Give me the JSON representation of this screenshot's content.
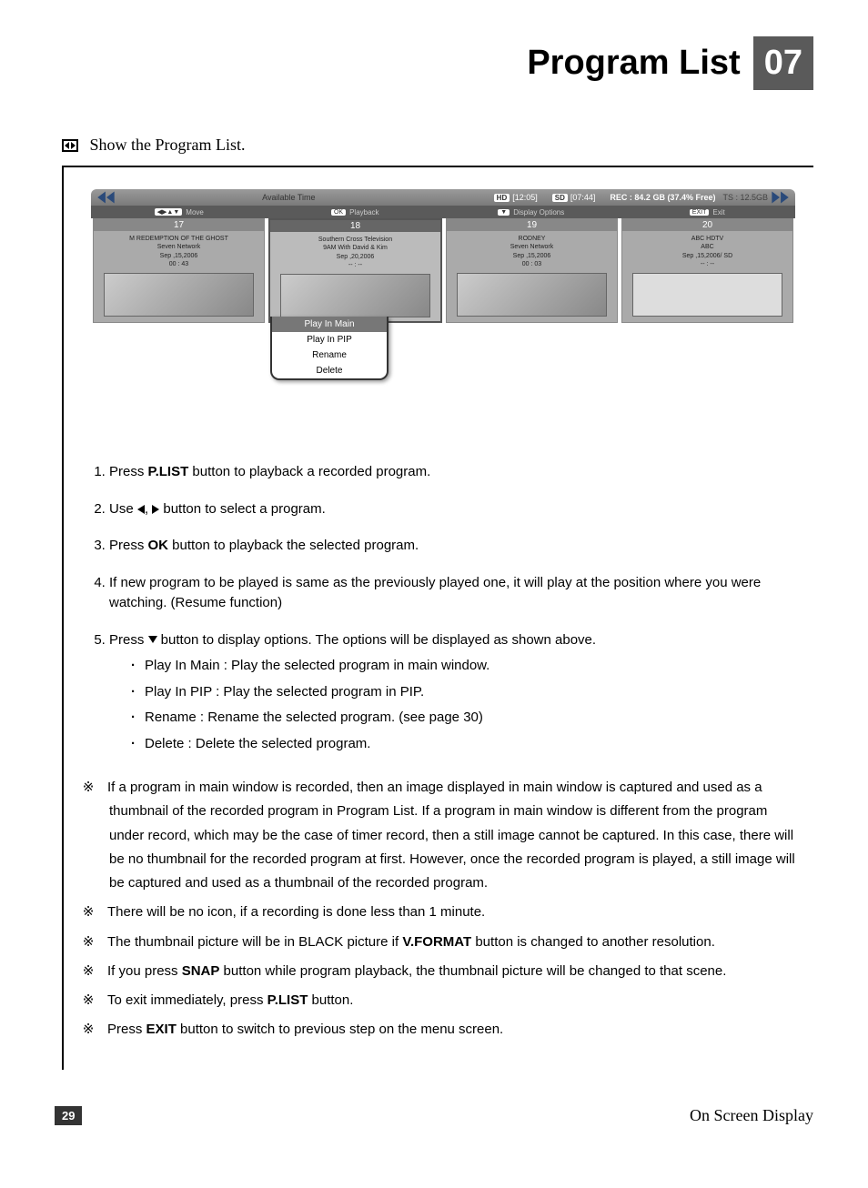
{
  "header": {
    "title": "Program List",
    "number": "07"
  },
  "intro": "Show the Program List.",
  "osd": {
    "availableLabel": "Available Time",
    "hd": "HD",
    "hdTime": "[12:05]",
    "sd": "SD",
    "sdTime": "[07:44]",
    "rec": "REC : 84.2 GB (37.4% Free)",
    "ts": "TS : 12.5GB",
    "hints": {
      "moveKey": "◀▶▲▼",
      "move": "Move",
      "okKey": "OK",
      "ok": "Playback",
      "downKey": "▼",
      "down": "Display Options",
      "exitKey": "EXIT",
      "exit": "Exit"
    },
    "cards": [
      {
        "num": "17",
        "title": "M REDEMPTION OF THE GHOST",
        "net": "Seven Network",
        "date": "Sep ,15,2006",
        "dur": "00 : 43"
      },
      {
        "num": "18",
        "title": "Southern Cross Television",
        "net": "9AM With David & Kim",
        "date": "Sep ,20,2006",
        "dur": "-- : --"
      },
      {
        "num": "19",
        "title": "RODNEY",
        "net": "Seven Network",
        "date": "Sep ,15,2006",
        "dur": "00 : 03"
      },
      {
        "num": "20",
        "title": "ABC HDTV",
        "net": "ABC",
        "date": "Sep ,15,2006/ SD",
        "dur": "-- : --"
      }
    ],
    "popup": [
      "Play In Main",
      "Play In PIP",
      "Rename",
      "Delete"
    ]
  },
  "steps": {
    "s1a": "Press ",
    "s1b": "P.LIST",
    "s1c": " button to playback a recorded program.",
    "s2a": "Use ",
    "s2b": " button to select a program.",
    "s3a": "Press ",
    "s3b": "OK",
    "s3c": " button to playback the selected program.",
    "s4": "If new program to be played is same as the previously played one, it will play at the position where you were watching. (Resume function)",
    "s5a": "Press ",
    "s5b": " button to display options. The options will be displayed as shown above.",
    "opts": [
      "Play In Main : Play the selected program in main window.",
      "Play In PIP : Play the selected program in PIP.",
      "Rename : Rename the selected program. (see page 30)",
      "Delete : Delete the selected program."
    ]
  },
  "notes": {
    "n1": "If a program in main window is recorded, then an image displayed in main window is captured and used as a thumbnail of the recorded program in Program List. If a program in main window is different from the program under record, which may be the case of timer record, then a still image cannot be captured. In this case, there will be no thumbnail for the recorded program at first. However, once the recorded program is played, a still image will be captured and used as a thumbnail of the recorded program.",
    "n2": "There will be no icon, if a recording is done less than 1 minute.",
    "n3a": "The thumbnail picture will be in BLACK picture if ",
    "n3b": "V.FORMAT",
    "n3c": " button is changed to another resolution.",
    "n4a": "If you press ",
    "n4b": "SNAP",
    "n4c": " button while program playback, the thumbnail picture will be changed to that scene.",
    "n5a": "To exit immediately, press ",
    "n5b": "P.LIST",
    "n5c": " button.",
    "n6a": "Press ",
    "n6b": "EXIT",
    "n6c": " button to switch to previous step on the menu screen."
  },
  "footer": {
    "page": "29",
    "section": "On Screen Display"
  }
}
